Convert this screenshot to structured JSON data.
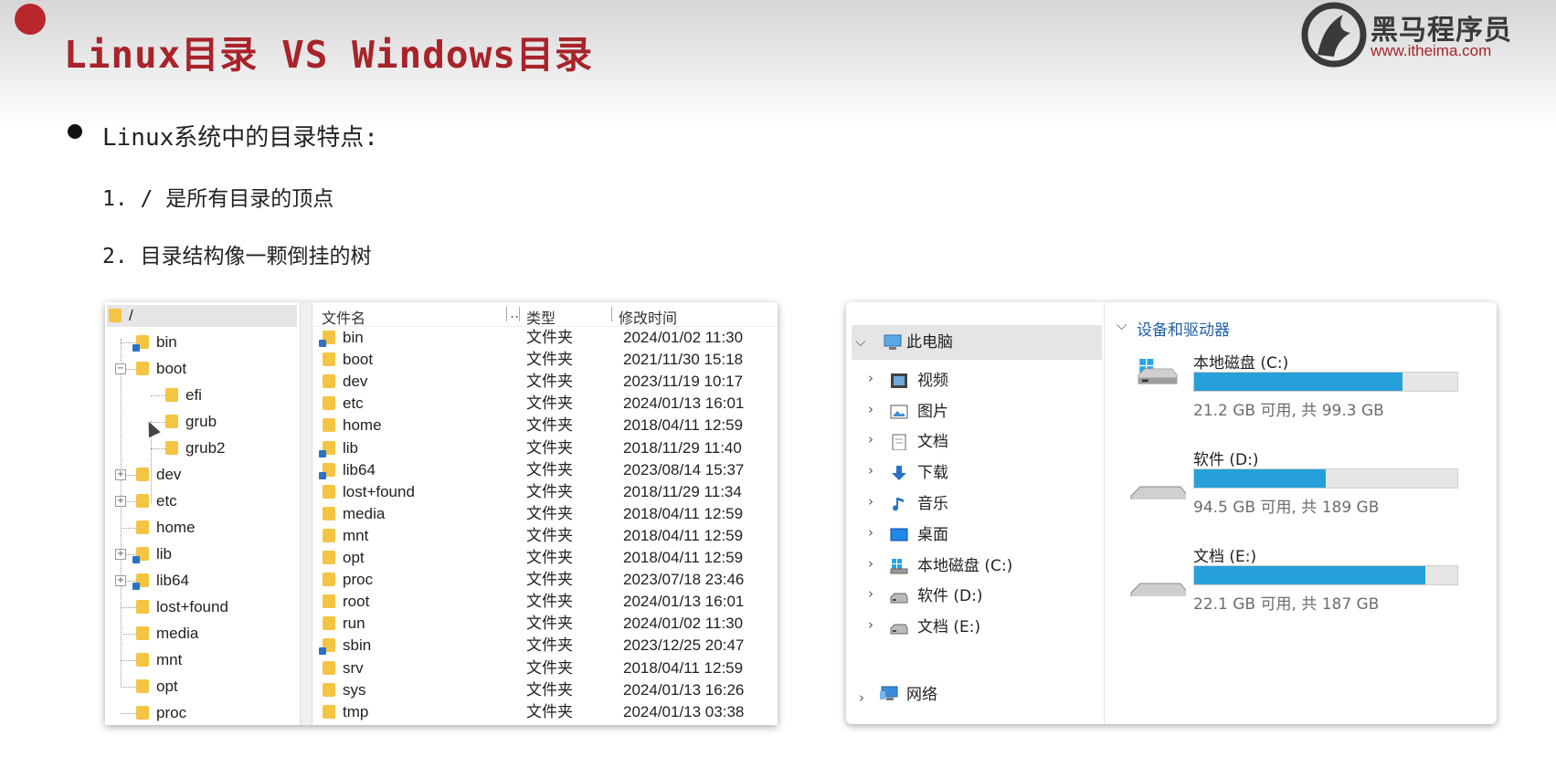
{
  "slide": {
    "title": "Linux目录 VS Windows目录",
    "logo": {
      "name": "黑马程序员",
      "url": "www.itheima.com"
    },
    "heading": "Linux系统中的目录特点:",
    "points": [
      "1. / 是所有目录的顶点",
      "2. 目录结构像一颗倒挂的树"
    ]
  },
  "linux": {
    "tree": [
      {
        "label": "/",
        "level": 0,
        "toggle": "",
        "link": false,
        "selected": true
      },
      {
        "label": "bin",
        "level": 1,
        "toggle": "",
        "link": true
      },
      {
        "label": "boot",
        "level": 1,
        "toggle": "minus",
        "link": false
      },
      {
        "label": "efi",
        "level": 2,
        "toggle": "",
        "link": false
      },
      {
        "label": "grub",
        "level": 2,
        "toggle": "",
        "link": false
      },
      {
        "label": "grub2",
        "level": 2,
        "toggle": "",
        "link": false
      },
      {
        "label": "dev",
        "level": 1,
        "toggle": "plus",
        "link": false
      },
      {
        "label": "etc",
        "level": 1,
        "toggle": "plus",
        "link": false
      },
      {
        "label": "home",
        "level": 1,
        "toggle": "",
        "link": false
      },
      {
        "label": "lib",
        "level": 1,
        "toggle": "plus",
        "link": true
      },
      {
        "label": "lib64",
        "level": 1,
        "toggle": "plus",
        "link": true
      },
      {
        "label": "lost+found",
        "level": 1,
        "toggle": "",
        "link": false
      },
      {
        "label": "media",
        "level": 1,
        "toggle": "",
        "link": false
      },
      {
        "label": "mnt",
        "level": 1,
        "toggle": "",
        "link": false
      },
      {
        "label": "opt",
        "level": 1,
        "toggle": "",
        "link": false
      },
      {
        "label": "proc",
        "level": 1,
        "toggle": "",
        "link": false
      }
    ],
    "columns": [
      "文件名",
      "..",
      "类型",
      "修改时间"
    ],
    "files": [
      {
        "name": "bin",
        "type": "文件夹",
        "modified": "2024/01/02 11:30",
        "link": true
      },
      {
        "name": "boot",
        "type": "文件夹",
        "modified": "2021/11/30 15:18",
        "link": false
      },
      {
        "name": "dev",
        "type": "文件夹",
        "modified": "2023/11/19 10:17",
        "link": false
      },
      {
        "name": "etc",
        "type": "文件夹",
        "modified": "2024/01/13 16:01",
        "link": false
      },
      {
        "name": "home",
        "type": "文件夹",
        "modified": "2018/04/11 12:59",
        "link": false
      },
      {
        "name": "lib",
        "type": "文件夹",
        "modified": "2018/11/29 11:40",
        "link": true
      },
      {
        "name": "lib64",
        "type": "文件夹",
        "modified": "2023/08/14 15:37",
        "link": true
      },
      {
        "name": "lost+found",
        "type": "文件夹",
        "modified": "2018/11/29 11:34",
        "link": false
      },
      {
        "name": "media",
        "type": "文件夹",
        "modified": "2018/04/11 12:59",
        "link": false
      },
      {
        "name": "mnt",
        "type": "文件夹",
        "modified": "2018/04/11 12:59",
        "link": false
      },
      {
        "name": "opt",
        "type": "文件夹",
        "modified": "2018/04/11 12:59",
        "link": false
      },
      {
        "name": "proc",
        "type": "文件夹",
        "modified": "2023/07/18 23:46",
        "link": false
      },
      {
        "name": "root",
        "type": "文件夹",
        "modified": "2024/01/13 16:01",
        "link": false
      },
      {
        "name": "run",
        "type": "文件夹",
        "modified": "2024/01/02 11:30",
        "link": false
      },
      {
        "name": "sbin",
        "type": "文件夹",
        "modified": "2023/12/25 20:47",
        "link": true
      },
      {
        "name": "srv",
        "type": "文件夹",
        "modified": "2018/04/11 12:59",
        "link": false
      },
      {
        "name": "sys",
        "type": "文件夹",
        "modified": "2024/01/13 16:26",
        "link": false
      },
      {
        "name": "tmp",
        "type": "文件夹",
        "modified": "2024/01/13 03:38",
        "link": false
      }
    ]
  },
  "windows": {
    "nav": {
      "root": "此电脑",
      "items": [
        {
          "label": "视频",
          "icon": "video-icon"
        },
        {
          "label": "图片",
          "icon": "pictures-icon"
        },
        {
          "label": "文档",
          "icon": "documents-icon"
        },
        {
          "label": "下载",
          "icon": "download-icon"
        },
        {
          "label": "音乐",
          "icon": "music-icon"
        },
        {
          "label": "桌面",
          "icon": "desktop-icon"
        },
        {
          "label": "本地磁盘 (C:)",
          "icon": "windows-drive-icon"
        },
        {
          "label": "软件 (D:)",
          "icon": "drive-icon"
        },
        {
          "label": "文档 (E:)",
          "icon": "drive-icon"
        }
      ],
      "network": "网络"
    },
    "section_title": "设备和驱动器",
    "drives": [
      {
        "name": "本地磁盘 (C:)",
        "info": "21.2 GB 可用, 共 99.3 GB",
        "used_fraction": 0.79,
        "system": true
      },
      {
        "name": "软件 (D:)",
        "info": "94.5 GB 可用, 共 189 GB",
        "used_fraction": 0.5,
        "system": false
      },
      {
        "name": "文档 (E:)",
        "info": "22.1 GB 可用, 共 187 GB",
        "used_fraction": 0.88,
        "system": false
      }
    ],
    "accent_color": "#26a0da"
  }
}
